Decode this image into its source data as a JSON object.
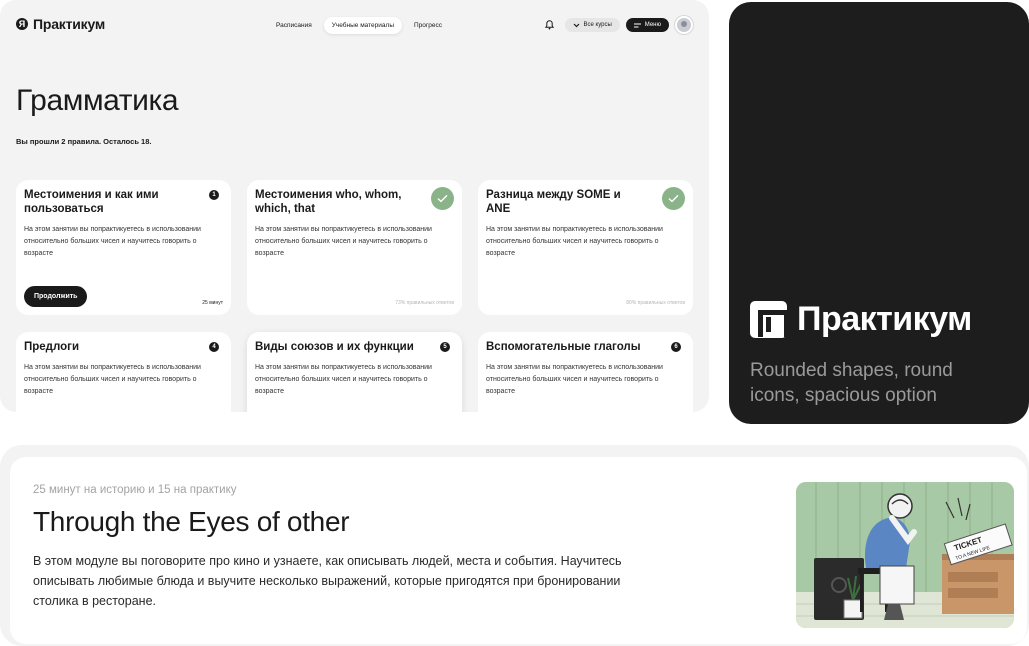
{
  "app": {
    "logo": {
      "mark": "Я",
      "text": "Практикум"
    },
    "nav": [
      {
        "label": "Расписания"
      },
      {
        "label": "Учебные материалы",
        "active": true
      },
      {
        "label": "Прогресс"
      }
    ],
    "top_right": {
      "courses_label": "Все курсы",
      "menu_label": "Меню"
    },
    "page": {
      "title": "Грамматика",
      "progress": "Вы прошли 2 правила. Осталось 18."
    },
    "cards": [
      {
        "title": "Местоимения и как ими пользоваться",
        "desc": "На этом занятии вы попрактикуетесь в использовании относительно больших чисел и научитесь говорить о возрасте",
        "badge": "1",
        "button": "Продолжить",
        "meta": "25 минут"
      },
      {
        "title": "Местоимения who, whom, which, that",
        "desc": "На этом занятии вы попрактикуетесь в использовании относительно больших чисел и научитесь говорить о возрасте",
        "meta": "73% правильных ответов"
      },
      {
        "title": "Разница между SOME и ANE",
        "desc": "На этом занятии вы попрактикуетесь в использовании относительно больших чисел и научитесь говорить о возрасте",
        "meta": "80% правильных ответов"
      },
      {
        "title": "Предлоги",
        "desc": "На этом занятии вы попрактикуетесь в использовании относительно больших чисел и научитесь говорить о возрасте",
        "badge": "4"
      },
      {
        "title": "Виды союзов и их функции",
        "desc": "На этом занятии вы попрактикуетесь в использовании относительно больших чисел и научитесь говорить о возрасте",
        "badge": "5"
      },
      {
        "title": "Вспомогательные глаголы",
        "desc": "На этом занятии вы попрактикуетесь в использовании относительно больших чисел и научитесь говорить о возрасте",
        "badge": "6"
      }
    ]
  },
  "brand": {
    "name": "Практикум",
    "caption": "Rounded shapes, round icons, spacious option"
  },
  "module": {
    "kicker": "25 минут на историю и 15 на практику",
    "title": "Through the Eyes of other",
    "desc": "В этом модуле вы поговорите про кино и узнаете, как описывать людей, места и события. Научитесь описывать любимые блюда и выучите несколько выражений, которые пригодятся при бронировании столика в ресторане.",
    "illustration_ticket": "TICKET TO A NEW LIFE"
  },
  "colors": {
    "accent_check": "#8ab38a",
    "dark": "#1a1a1a",
    "brand_bg": "#1d1d1d",
    "surface": "#f3f3f3"
  }
}
